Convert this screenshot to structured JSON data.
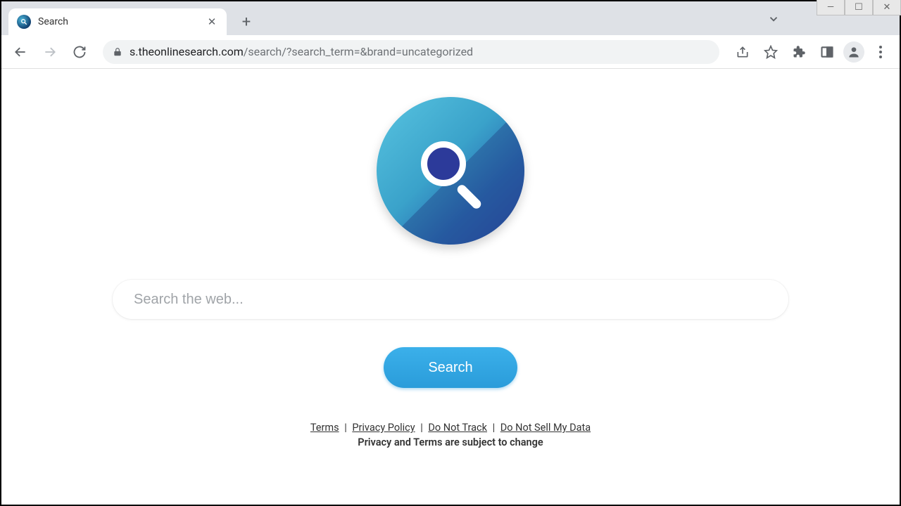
{
  "window": {
    "minimize_glyph": "—",
    "maximize_glyph": "☐",
    "close_glyph": "✕"
  },
  "tab": {
    "title": "Search",
    "close_glyph": "✕",
    "new_tab_glyph": "+"
  },
  "toolbar": {
    "url_domain": "s.theonlinesearch.com",
    "url_path": "/search/?search_term=&brand=uncategorized"
  },
  "page": {
    "search_placeholder": "Search the web...",
    "search_button_label": "Search"
  },
  "footer": {
    "links": {
      "terms": "Terms",
      "privacy": "Privacy Policy",
      "dnt": "Do Not Track",
      "dnsmd": "Do Not Sell My Data"
    },
    "separator": " | ",
    "note": "Privacy and Terms are subject to change"
  }
}
